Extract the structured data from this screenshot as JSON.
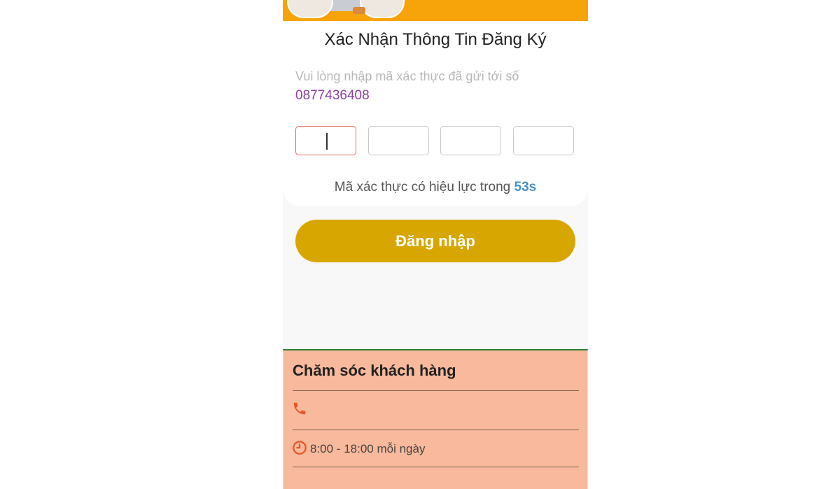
{
  "header": {
    "title": "Xác Nhận Thông Tin Đăng Ký"
  },
  "verification": {
    "hint": "Vui lòng nhập mã xác thực đã gửi tới số",
    "phone_number": "0877436408",
    "otp_digits": [
      "",
      "",
      "",
      ""
    ],
    "timer_prefix": "Mã xác thực có hiệu lực trong",
    "timer_value": "53s"
  },
  "actions": {
    "login_label": "Đăng nhập"
  },
  "support": {
    "title": "Chăm sóc khách hàng",
    "hours": "8:00 - 18:00 mỗi ngày"
  },
  "colors": {
    "banner": "#f7a30a",
    "login_button": "#d8a600",
    "phone_number": "#8e3fa0",
    "timer": "#4a90c8",
    "support_bg": "#f8b99c",
    "icon": "#e8562a"
  },
  "icons": [
    "phone-icon",
    "clock-icon"
  ]
}
